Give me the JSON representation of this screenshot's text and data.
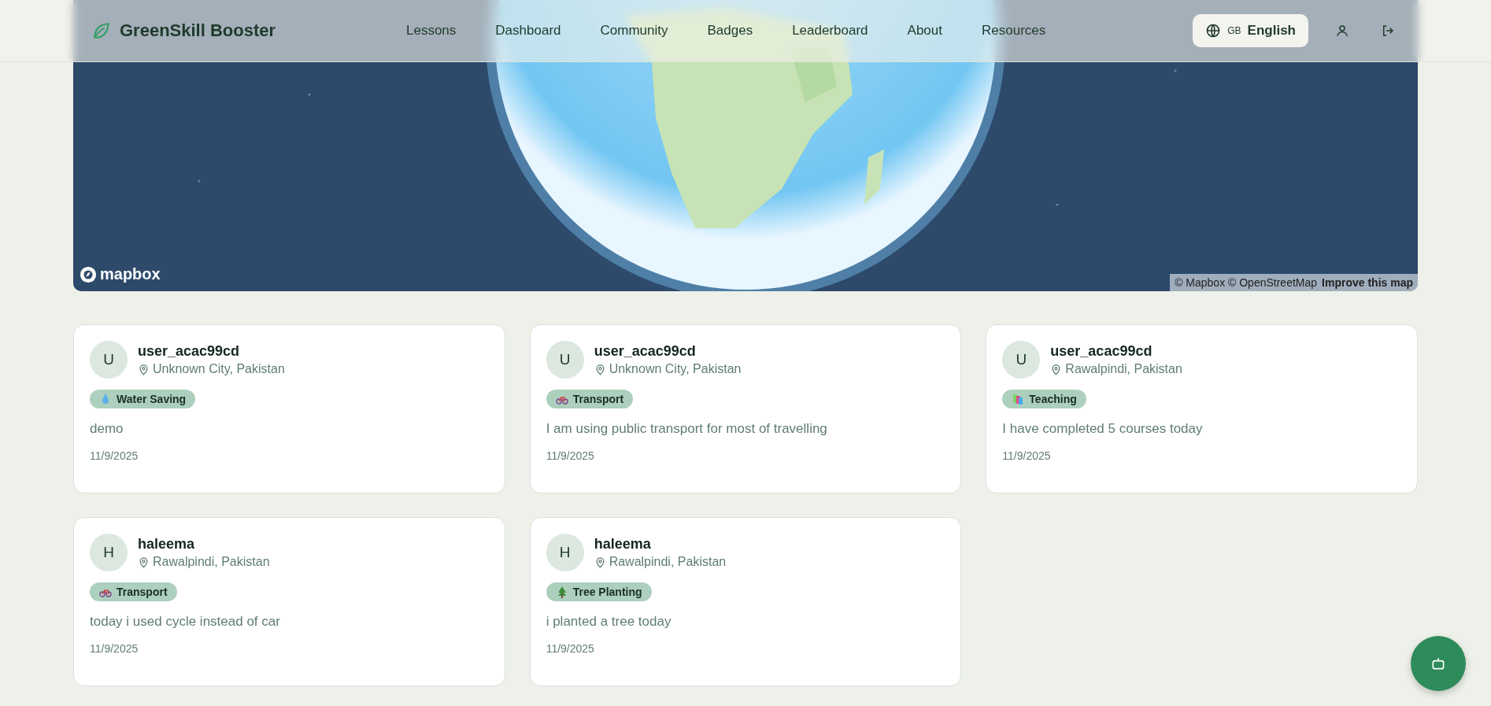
{
  "header": {
    "brand": "GreenSkill Booster",
    "nav": [
      {
        "label": "Lessons"
      },
      {
        "label": "Dashboard"
      },
      {
        "label": "Community"
      },
      {
        "label": "Badges"
      },
      {
        "label": "Leaderboard"
      },
      {
        "label": "About"
      },
      {
        "label": "Resources"
      }
    ],
    "language": {
      "flag": "GB",
      "label": "English"
    }
  },
  "map": {
    "logo": "mapbox",
    "attribution": "© Mapbox © OpenStreetMap",
    "improve_link": "Improve this map"
  },
  "posts": [
    {
      "initial": "U",
      "user": "user_acac99cd",
      "location": "Unknown City, Pakistan",
      "tag": {
        "kind": "water",
        "label": "Water Saving"
      },
      "text": "demo",
      "date": "11/9/2025"
    },
    {
      "initial": "U",
      "user": "user_acac99cd",
      "location": "Unknown City, Pakistan",
      "tag": {
        "kind": "bike",
        "label": "Transport"
      },
      "text": "I am using public transport for most of travelling",
      "date": "11/9/2025"
    },
    {
      "initial": "U",
      "user": "user_acac99cd",
      "location": "Rawalpindi, Pakistan",
      "tag": {
        "kind": "books",
        "label": "Teaching"
      },
      "text": "I have completed 5 courses today",
      "date": "11/9/2025"
    },
    {
      "initial": "H",
      "user": "haleema",
      "location": "Rawalpindi, Pakistan",
      "tag": {
        "kind": "bike",
        "label": "Transport"
      },
      "text": "today i used cycle instead of car",
      "date": "11/9/2025"
    },
    {
      "initial": "H",
      "user": "haleema",
      "location": "Rawalpindi, Pakistan",
      "tag": {
        "kind": "tree",
        "label": "Tree Planting"
      },
      "text": "i planted a tree today",
      "date": "11/9/2025"
    }
  ]
}
